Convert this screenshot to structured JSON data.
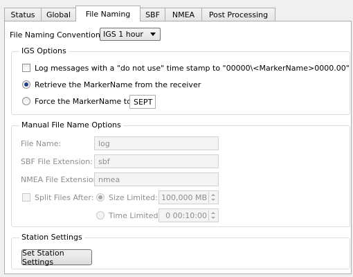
{
  "tabs": [
    {
      "label": "Status"
    },
    {
      "label": "Global"
    },
    {
      "label": "File Naming"
    },
    {
      "label": "SBF"
    },
    {
      "label": "NMEA"
    },
    {
      "label": "Post Processing"
    }
  ],
  "naming": {
    "label": "File Naming Convention:",
    "value": "IGS 1 hour"
  },
  "igs": {
    "title": "IGS Options",
    "log_label": "Log messages with a \"do not use\" time stamp to \"00000\\<MarkerName>0000.00\"",
    "log_checked": false,
    "retrieve_label": "Retrieve the MarkerName from the receiver",
    "force_label": "Force the MarkerName to:",
    "force_value": "SEPT",
    "selected": "retrieve"
  },
  "manual": {
    "title": "Manual File Name Options",
    "file_name_label": "File Name:",
    "file_name_value": "log",
    "sbf_ext_label": "SBF File Extension:",
    "sbf_ext_value": "sbf",
    "nmea_ext_label": "NMEA File Extension:",
    "nmea_ext_value": "nmea",
    "split_label": "Split Files After:",
    "size_label": "Size Limited:",
    "size_value": "100,000 MB",
    "time_label": "Time Limited:",
    "time_value": "0 00:10:00"
  },
  "station": {
    "title": "Station Settings",
    "button_label": "Set Station Settings"
  }
}
